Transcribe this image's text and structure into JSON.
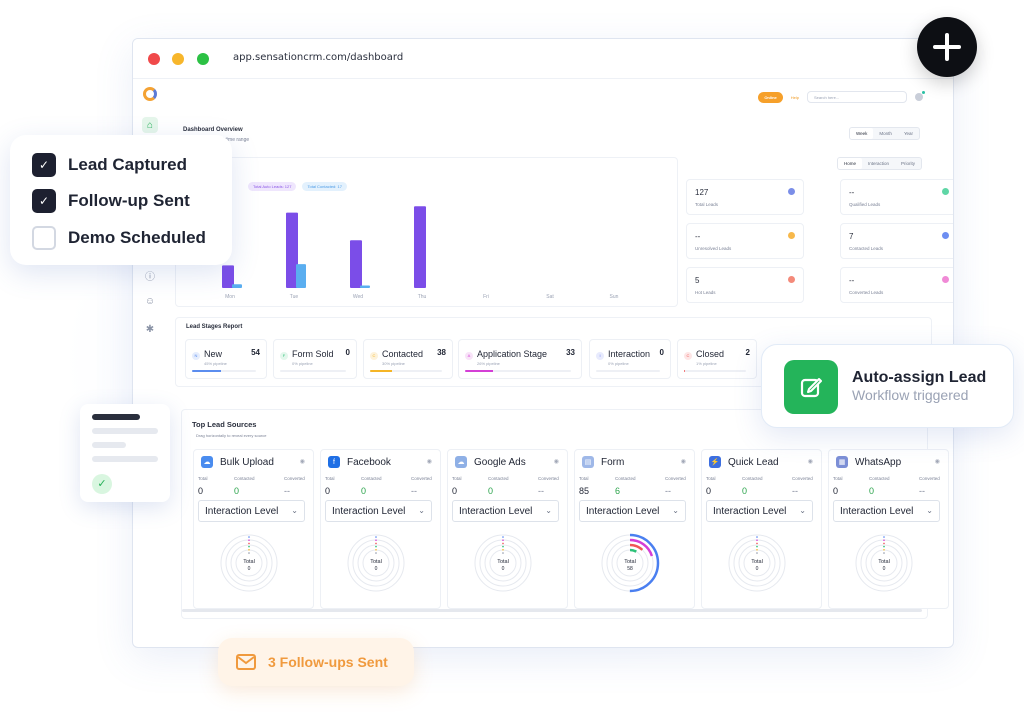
{
  "browser": {
    "url": "app.sensationcrm.com/dashboard"
  },
  "topbar": {
    "status_pill": "Online",
    "link": "Help",
    "search_placeholder": "Search here..."
  },
  "dashboard": {
    "title": "Dashboard Overview",
    "subtitle": "Based on selected time range",
    "range_tabs": [
      "Week",
      "Month",
      "Year"
    ],
    "view_tabs": [
      "Home",
      "Interaction",
      "Priority"
    ],
    "chips": [
      "Total Auto Leads: 127",
      "Total Contacted: 17"
    ],
    "chart_days": [
      "Mon",
      "Tue",
      "Wed",
      "Thu",
      "Fri",
      "Sat",
      "Sun"
    ]
  },
  "chart_data": {
    "type": "bar",
    "categories": [
      "Mon",
      "Tue",
      "Wed",
      "Thu",
      "Fri",
      "Sat",
      "Sun"
    ],
    "series": [
      {
        "values": [
          18,
          60,
          38,
          65,
          0,
          0,
          0
        ],
        "color": "#7b4de8"
      },
      {
        "values": [
          3,
          19,
          2,
          0,
          0,
          0,
          0
        ],
        "color": "#5aaef0"
      }
    ],
    "ylim": [
      0,
      70
    ],
    "grid": false
  },
  "stats": [
    {
      "value": "127",
      "label": "Total Leads",
      "color": "#7b8ee8"
    },
    {
      "value": "--",
      "label": "Qualified Leads",
      "color": "#5fd6a6"
    },
    {
      "value": "--",
      "label": "Unresolved Leads",
      "color": "#f7b84b"
    },
    {
      "value": "7",
      "label": "Contacted Leads",
      "color": "#6d8ef2"
    },
    {
      "value": "5",
      "label": "Hot Leads",
      "color": "#f48a7a"
    },
    {
      "value": "--",
      "label": "Converted Leads",
      "color": "#f08ad6"
    }
  ],
  "stages_title": "Lead Stages Report",
  "stages": [
    {
      "name": "New",
      "count": "54",
      "pipeline": "45% pipeline",
      "fill": 0.45,
      "color": "#5b8def",
      "badge": "N",
      "badge_bg": "#e5edfd"
    },
    {
      "name": "Form Sold",
      "count": "0",
      "pipeline": "0% pipeline",
      "fill": 0.0,
      "color": "#2cc178",
      "badge": "F",
      "badge_bg": "#e3f7ec"
    },
    {
      "name": "Contacted",
      "count": "38",
      "pipeline": "30% pipeline",
      "fill": 0.3,
      "color": "#f5b526",
      "badge": "C",
      "badge_bg": "#fdf2da"
    },
    {
      "name": "Application Stage",
      "count": "33",
      "pipeline": "26% pipeline",
      "fill": 0.26,
      "color": "#d43fd6",
      "badge": "A",
      "badge_bg": "#f8e3f8"
    },
    {
      "name": "Interaction",
      "count": "0",
      "pipeline": "0% pipeline",
      "fill": 0.0,
      "color": "#6c7ef0",
      "badge": "I",
      "badge_bg": "#e8ebfd"
    },
    {
      "name": "Closed",
      "count": "2",
      "pipeline": "1% pipeline",
      "fill": 0.01,
      "color": "#f05656",
      "badge": "C",
      "badge_bg": "#fde6e6"
    }
  ],
  "sources_title": "Top Lead Sources",
  "sources_hint": "Drag horizontally to reveal every source",
  "source_cols": [
    "Total",
    "Contacted",
    "Converted"
  ],
  "dropdown_label": "Interaction Level",
  "donut_label": "Total",
  "sources": [
    {
      "name": "Bulk Upload",
      "icon": "cloud-upload-icon",
      "glyph": "☁",
      "icon_bg": "#4a8cef",
      "total": "0",
      "contacted": "0",
      "converted": "--",
      "donut_total": "0",
      "active": false
    },
    {
      "name": "Facebook",
      "icon": "facebook-icon",
      "glyph": "f",
      "icon_bg": "#1f6fe5",
      "total": "0",
      "contacted": "0",
      "converted": "--",
      "donut_total": "0",
      "active": false
    },
    {
      "name": "Google Ads",
      "icon": "google-ads-icon",
      "glyph": "☁",
      "icon_bg": "#8fb0e6",
      "total": "0",
      "contacted": "0",
      "converted": "--",
      "donut_total": "0",
      "active": false
    },
    {
      "name": "Form",
      "icon": "form-icon",
      "glyph": "▤",
      "icon_bg": "#9fb8e8",
      "total": "85",
      "contacted": "6",
      "converted": "--",
      "donut_total": "58",
      "active": true
    },
    {
      "name": "Quick Lead",
      "icon": "lightning-icon",
      "glyph": "⚡",
      "icon_bg": "#3d6fe0",
      "total": "0",
      "contacted": "0",
      "converted": "--",
      "donut_total": "0",
      "active": false
    },
    {
      "name": "WhatsApp",
      "icon": "whatsapp-icon",
      "glyph": "▦",
      "icon_bg": "#7c8fd6",
      "total": "0",
      "contacted": "0",
      "converted": "--",
      "donut_total": "0",
      "active": false
    }
  ],
  "checklist": [
    {
      "label": "Lead Captured",
      "checked": true
    },
    {
      "label": "Follow-up Sent",
      "checked": true
    },
    {
      "label": "Demo Scheduled",
      "checked": false
    }
  ],
  "auto_assign": {
    "title": "Auto-assign Lead",
    "subtitle": "Workflow triggered"
  },
  "followups": {
    "label": "3 Follow-ups Sent"
  },
  "colors": {
    "accent_green": "#24b45a",
    "accent_purple": "#7b4de8",
    "accent_orange": "#f09a3e"
  }
}
